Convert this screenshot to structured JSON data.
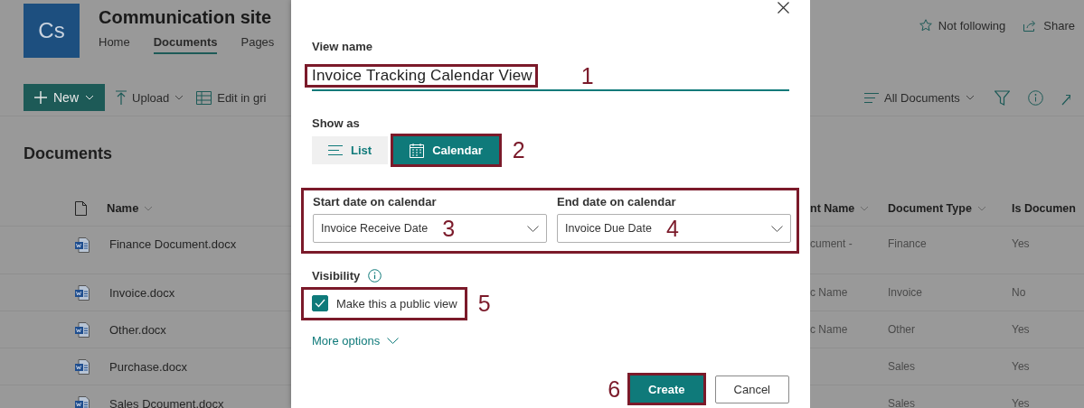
{
  "site": {
    "logo": "Cs",
    "title": "Communication site",
    "nav": [
      {
        "label": "Home",
        "selected": false
      },
      {
        "label": "Documents",
        "selected": true
      },
      {
        "label": "Pages",
        "selected": false
      }
    ],
    "actions": [
      {
        "label": "Not following",
        "kind": "follow"
      },
      {
        "label": "Share",
        "kind": "share"
      }
    ]
  },
  "toolbar": {
    "left": [
      {
        "label": "New",
        "kind": "primary"
      },
      {
        "label": "Upload",
        "kind": "upload"
      },
      {
        "label": "Edit in gri",
        "kind": "grid"
      }
    ],
    "view": "All Documents"
  },
  "library": {
    "title": "Documents",
    "name_column": "Name",
    "columns": [
      "nt Name",
      "Document Type",
      "Is Documen"
    ],
    "rows": [
      {
        "name": "Finance Document.docx",
        "cells": [
          "cument -",
          "Finance",
          "Yes"
        ]
      },
      {
        "name": "Invoice.docx",
        "cells": [
          "c Name",
          "Invoice",
          "No"
        ]
      },
      {
        "name": "Other.docx",
        "cells": [
          "c Name",
          "Other",
          "Yes"
        ]
      },
      {
        "name": "Purchase.docx",
        "cells": [
          "",
          "Sales",
          "Yes"
        ]
      },
      {
        "name": "Sales Dcoument.docx",
        "cells": [
          "",
          "Sales",
          "Yes"
        ]
      }
    ]
  },
  "dialog": {
    "view_name": {
      "label": "View name",
      "value": "Invoice Tracking Calendar View",
      "marker": "1"
    },
    "show_as": {
      "label": "Show as",
      "options": [
        {
          "label": "List",
          "kind": "list",
          "selected": false
        },
        {
          "label": "Calendar",
          "kind": "calendar",
          "selected": true,
          "marker": "2"
        }
      ]
    },
    "dates": [
      {
        "label": "Start date on calendar",
        "value": "Invoice Receive Date",
        "marker": "3"
      },
      {
        "label": "End date on calendar",
        "value": "Invoice Due Date",
        "marker": "4"
      }
    ],
    "visibility": {
      "label": "Visibility",
      "checkbox": {
        "label": "Make this a public view",
        "checked": true
      },
      "marker": "5"
    },
    "more_options": "More options",
    "buttons": [
      {
        "label": "Create",
        "kind": "primary",
        "marker": "6"
      },
      {
        "label": "Cancel",
        "kind": "default"
      }
    ]
  }
}
